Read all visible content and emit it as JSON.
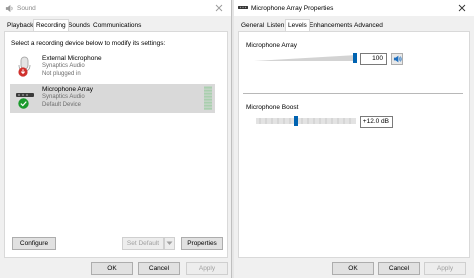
{
  "sound": {
    "title": "Sound",
    "tabs": [
      "Playback",
      "Recording",
      "Sounds",
      "Communications"
    ],
    "active_tab": "Recording",
    "instruction": "Select a recording device below to modify its settings:",
    "devices": [
      {
        "name": "External Microphone",
        "driver": "Synaptics Audio",
        "status": "Not plugged in",
        "selected": false
      },
      {
        "name": "Microphone Array",
        "driver": "Synaptics Audio",
        "status": "Default Device",
        "selected": true
      }
    ],
    "buttons": {
      "configure": "Configure",
      "set_default": "Set Default",
      "properties": "Properties"
    },
    "footer": {
      "ok": "OK",
      "cancel": "Cancel",
      "apply": "Apply"
    }
  },
  "props": {
    "title": "Microphone Array Properties",
    "tabs": [
      "General",
      "Listen",
      "Levels",
      "Enhancements",
      "Advanced"
    ],
    "active_tab": "Levels",
    "array": {
      "label": "Microphone Array",
      "value": "100",
      "level": 1.0
    },
    "boost": {
      "label": "Microphone Boost",
      "value": "+12.0 dB",
      "level": 0.4
    },
    "footer": {
      "ok": "OK",
      "cancel": "Cancel",
      "apply": "Apply"
    }
  },
  "colors": {
    "accent": "#0063b1",
    "check": "#1a9a2c",
    "unplugged": "#d0312d"
  }
}
